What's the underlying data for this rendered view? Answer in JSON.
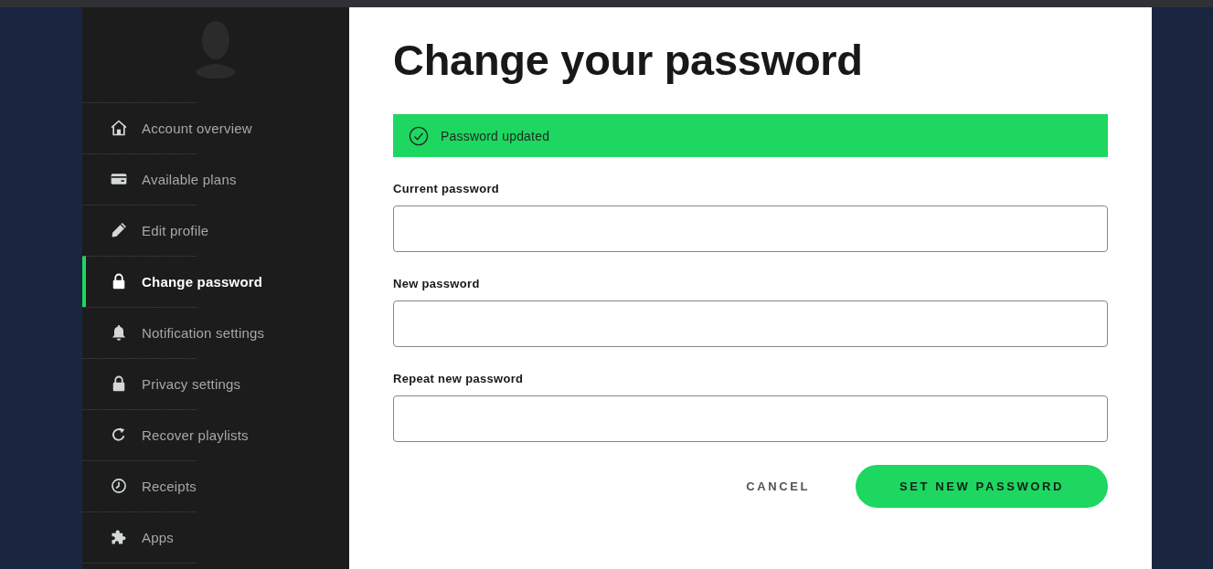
{
  "sidebar": {
    "items": [
      {
        "label": "Account overview",
        "selected": false
      },
      {
        "label": "Available plans",
        "selected": false
      },
      {
        "label": "Edit profile",
        "selected": false
      },
      {
        "label": "Change password",
        "selected": true
      },
      {
        "label": "Notification settings",
        "selected": false
      },
      {
        "label": "Privacy settings",
        "selected": false
      },
      {
        "label": "Recover playlists",
        "selected": false
      },
      {
        "label": "Receipts",
        "selected": false
      },
      {
        "label": "Apps",
        "selected": false
      }
    ]
  },
  "page": {
    "title": "Change your password"
  },
  "alert": {
    "kind": "success",
    "message": "Password updated"
  },
  "form": {
    "fields": [
      {
        "label": "Current password"
      },
      {
        "label": "New password"
      },
      {
        "label": "Repeat new password"
      }
    ]
  },
  "actions": [
    {
      "label": "CANCEL",
      "kind": "text"
    },
    {
      "label": "SET NEW PASSWORD",
      "kind": "primary"
    }
  ]
}
